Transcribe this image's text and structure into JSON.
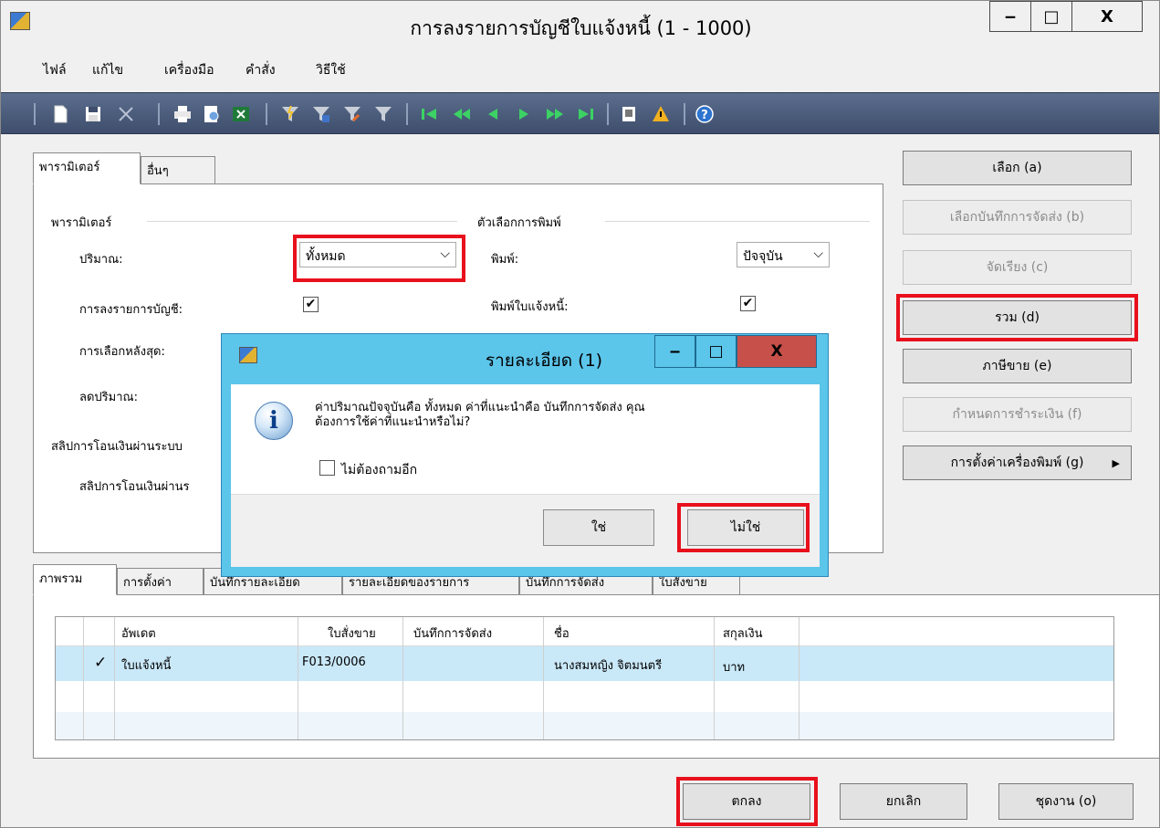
{
  "window": {
    "title": "การลงรายการบัญชีใบแจ้งหนี้ (1 - 1000)",
    "minimize_glyph": "‒",
    "maximize_glyph": "□",
    "close_glyph": "X"
  },
  "menu": [
    "ไฟล์",
    "แก้ไข",
    "เครื่องมือ",
    "คำสั่ง",
    "วิธีใช้"
  ],
  "toolbar": {
    "icons": [
      "new-icon",
      "save-icon",
      "delete-icon",
      "print-icon",
      "print-preview-icon",
      "export-excel-icon",
      "filter-by-selection-icon",
      "filter-by-field-icon",
      "advanced-filter-icon",
      "remove-filter-icon",
      "first-record-icon",
      "previous-page-icon",
      "previous-record-icon",
      "next-record-icon",
      "next-page-icon",
      "last-record-icon",
      "attachments-icon",
      "alerts-icon",
      "help-icon"
    ]
  },
  "tabs_top": [
    "พารามิเตอร์",
    "อื่นๆ"
  ],
  "params": {
    "group_title": "พารามิเตอร์",
    "quantity_label": "ปริมาณ:",
    "quantity_value": "ทั้งหมด",
    "posting_label": "การลงรายการบัญชี:",
    "late_selection_label": "การเลือกหลังสุด:",
    "reduce_qty_label": "ลดปริมาณ:",
    "bank_slip_group": "สลิปการโอนเงินผ่านระบบ",
    "bank_slip_label": "สลิปการโอนเงินผ่านร"
  },
  "print_options": {
    "group_title": "ตัวเลือกการพิมพ์",
    "print_label": "พิมพ์:",
    "print_value": "ปัจจุบัน",
    "print_invoice_label": "พิมพ์ใบแจ้งหนี้:"
  },
  "check_glyph": "✔",
  "right_buttons": [
    {
      "label": "เลือก (a)",
      "enabled": true
    },
    {
      "label": "เลือกบันทึกการจัดส่ง (b)",
      "enabled": false
    },
    {
      "label": "จัดเรียง (c)",
      "enabled": false
    },
    {
      "label": "รวม (d)",
      "enabled": true
    },
    {
      "label": "ภาษีขาย (e)",
      "enabled": true
    },
    {
      "label": "กำหนดการชำระเงิน (f)",
      "enabled": false
    },
    {
      "label": "การตั้งค่าเครื่องพิมพ์ (g)",
      "enabled": true
    }
  ],
  "submenu_arrow": "▶",
  "tabs_bottom": [
    "ภาพรวม",
    "การตั้งค่า",
    "บันทึกรายละเอียด",
    "รายละเอียดของรายการ",
    "บันทึกการจัดส่ง",
    "ใบสั่งขาย"
  ],
  "grid": {
    "columns": [
      "อัพเดต",
      "ใบสั่งขาย",
      "บันทึกการจัดส่ง",
      "ชื่อ",
      "สกุลเงิน"
    ],
    "rows": [
      {
        "check": "✓",
        "update": "ใบแจ้งหนี้",
        "sales_order": "F013/0006",
        "packing_slip": "",
        "name": "นางสมหญิง จิตมนตรี",
        "currency": "บาท"
      }
    ]
  },
  "bottom_buttons": [
    "ตกลง",
    "ยกเลิก",
    "ชุดงาน (o)"
  ],
  "dialog": {
    "title": "รายละเอียด (1)",
    "message_line1": "ค่าปริมาณปัจจุบันคือ ทั้งหมด ค่าที่แนะนำคือ บันทึกการจัดส่ง คุณ",
    "message_line2": "ต้องการใช้ค่าที่แนะนำหรือไม่?",
    "dont_ask_label": "ไม่ต้องถามอีก",
    "yes_label": "ใช่",
    "no_label": "ไม่ใช่",
    "info_glyph": "i"
  },
  "colors": {
    "highlight": "#e8101c",
    "dialog_frame": "#5cc5ea",
    "dialog_close": "#c8504a",
    "toolbar": "#4a5a78",
    "grid_selected_row": "#c9e8f8"
  }
}
